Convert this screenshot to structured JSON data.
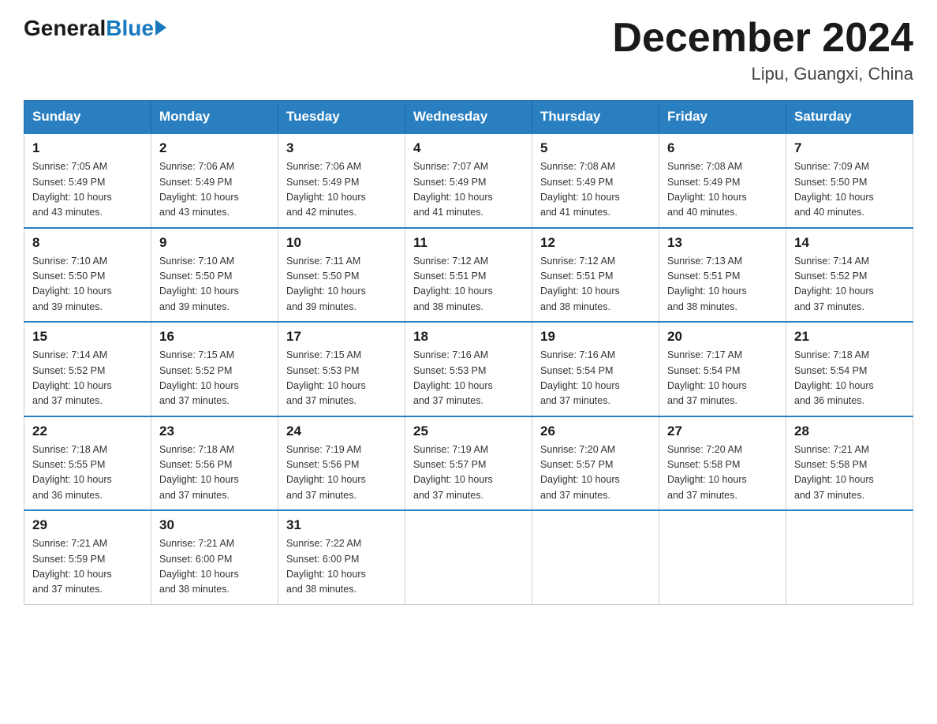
{
  "header": {
    "logo_general": "General",
    "logo_blue": "Blue",
    "month_title": "December 2024",
    "location": "Lipu, Guangxi, China"
  },
  "days_of_week": [
    "Sunday",
    "Monday",
    "Tuesday",
    "Wednesday",
    "Thursday",
    "Friday",
    "Saturday"
  ],
  "weeks": [
    [
      {
        "day": "1",
        "sunrise": "7:05 AM",
        "sunset": "5:49 PM",
        "daylight": "10 hours and 43 minutes."
      },
      {
        "day": "2",
        "sunrise": "7:06 AM",
        "sunset": "5:49 PM",
        "daylight": "10 hours and 43 minutes."
      },
      {
        "day": "3",
        "sunrise": "7:06 AM",
        "sunset": "5:49 PM",
        "daylight": "10 hours and 42 minutes."
      },
      {
        "day": "4",
        "sunrise": "7:07 AM",
        "sunset": "5:49 PM",
        "daylight": "10 hours and 41 minutes."
      },
      {
        "day": "5",
        "sunrise": "7:08 AM",
        "sunset": "5:49 PM",
        "daylight": "10 hours and 41 minutes."
      },
      {
        "day": "6",
        "sunrise": "7:08 AM",
        "sunset": "5:49 PM",
        "daylight": "10 hours and 40 minutes."
      },
      {
        "day": "7",
        "sunrise": "7:09 AM",
        "sunset": "5:50 PM",
        "daylight": "10 hours and 40 minutes."
      }
    ],
    [
      {
        "day": "8",
        "sunrise": "7:10 AM",
        "sunset": "5:50 PM",
        "daylight": "10 hours and 39 minutes."
      },
      {
        "day": "9",
        "sunrise": "7:10 AM",
        "sunset": "5:50 PM",
        "daylight": "10 hours and 39 minutes."
      },
      {
        "day": "10",
        "sunrise": "7:11 AM",
        "sunset": "5:50 PM",
        "daylight": "10 hours and 39 minutes."
      },
      {
        "day": "11",
        "sunrise": "7:12 AM",
        "sunset": "5:51 PM",
        "daylight": "10 hours and 38 minutes."
      },
      {
        "day": "12",
        "sunrise": "7:12 AM",
        "sunset": "5:51 PM",
        "daylight": "10 hours and 38 minutes."
      },
      {
        "day": "13",
        "sunrise": "7:13 AM",
        "sunset": "5:51 PM",
        "daylight": "10 hours and 38 minutes."
      },
      {
        "day": "14",
        "sunrise": "7:14 AM",
        "sunset": "5:52 PM",
        "daylight": "10 hours and 37 minutes."
      }
    ],
    [
      {
        "day": "15",
        "sunrise": "7:14 AM",
        "sunset": "5:52 PM",
        "daylight": "10 hours and 37 minutes."
      },
      {
        "day": "16",
        "sunrise": "7:15 AM",
        "sunset": "5:52 PM",
        "daylight": "10 hours and 37 minutes."
      },
      {
        "day": "17",
        "sunrise": "7:15 AM",
        "sunset": "5:53 PM",
        "daylight": "10 hours and 37 minutes."
      },
      {
        "day": "18",
        "sunrise": "7:16 AM",
        "sunset": "5:53 PM",
        "daylight": "10 hours and 37 minutes."
      },
      {
        "day": "19",
        "sunrise": "7:16 AM",
        "sunset": "5:54 PM",
        "daylight": "10 hours and 37 minutes."
      },
      {
        "day": "20",
        "sunrise": "7:17 AM",
        "sunset": "5:54 PM",
        "daylight": "10 hours and 37 minutes."
      },
      {
        "day": "21",
        "sunrise": "7:18 AM",
        "sunset": "5:54 PM",
        "daylight": "10 hours and 36 minutes."
      }
    ],
    [
      {
        "day": "22",
        "sunrise": "7:18 AM",
        "sunset": "5:55 PM",
        "daylight": "10 hours and 36 minutes."
      },
      {
        "day": "23",
        "sunrise": "7:18 AM",
        "sunset": "5:56 PM",
        "daylight": "10 hours and 37 minutes."
      },
      {
        "day": "24",
        "sunrise": "7:19 AM",
        "sunset": "5:56 PM",
        "daylight": "10 hours and 37 minutes."
      },
      {
        "day": "25",
        "sunrise": "7:19 AM",
        "sunset": "5:57 PM",
        "daylight": "10 hours and 37 minutes."
      },
      {
        "day": "26",
        "sunrise": "7:20 AM",
        "sunset": "5:57 PM",
        "daylight": "10 hours and 37 minutes."
      },
      {
        "day": "27",
        "sunrise": "7:20 AM",
        "sunset": "5:58 PM",
        "daylight": "10 hours and 37 minutes."
      },
      {
        "day": "28",
        "sunrise": "7:21 AM",
        "sunset": "5:58 PM",
        "daylight": "10 hours and 37 minutes."
      }
    ],
    [
      {
        "day": "29",
        "sunrise": "7:21 AM",
        "sunset": "5:59 PM",
        "daylight": "10 hours and 37 minutes."
      },
      {
        "day": "30",
        "sunrise": "7:21 AM",
        "sunset": "6:00 PM",
        "daylight": "10 hours and 38 minutes."
      },
      {
        "day": "31",
        "sunrise": "7:22 AM",
        "sunset": "6:00 PM",
        "daylight": "10 hours and 38 minutes."
      },
      null,
      null,
      null,
      null
    ]
  ],
  "labels": {
    "sunrise": "Sunrise:",
    "sunset": "Sunset:",
    "daylight": "Daylight:"
  }
}
